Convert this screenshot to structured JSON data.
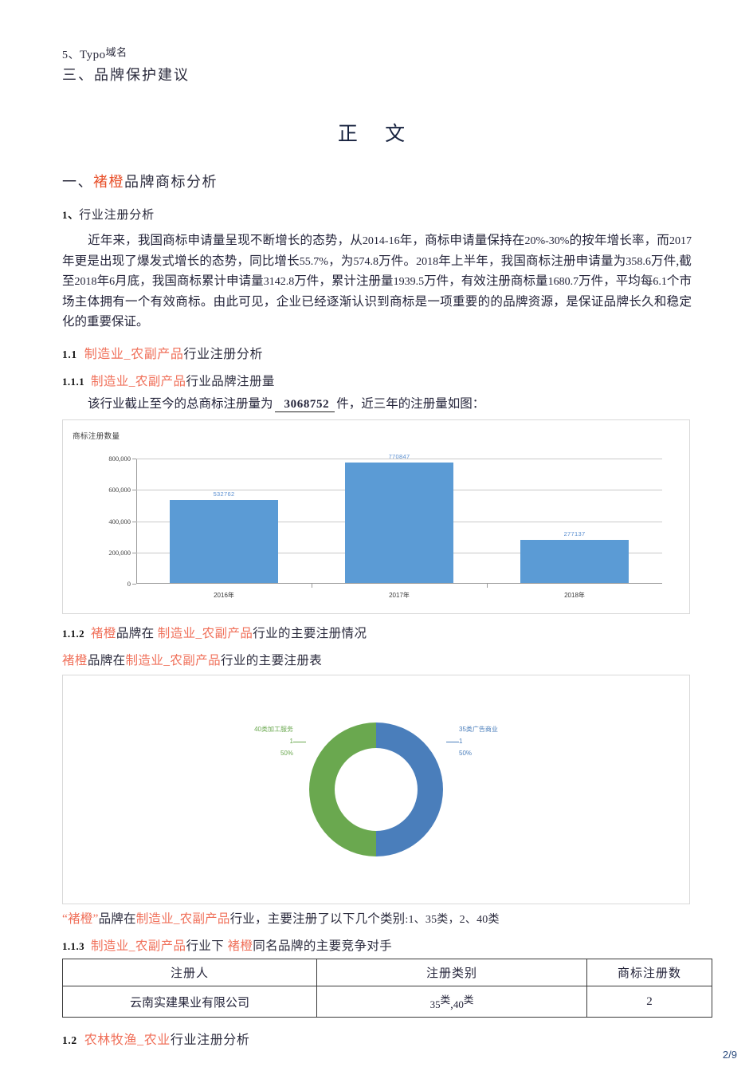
{
  "page": {
    "number_label": "2/9"
  },
  "header": {
    "toc_item_5_num": "5、",
    "toc_item_5_text": "Typo",
    "toc_item_5_sup": "域名",
    "toc_item_3": "三、品牌保护建议",
    "doc_title": "正  文"
  },
  "sections": {
    "s1_title_num": "一、",
    "s1_title_brand": "褚橙",
    "s1_title_rest": "品牌商标分析",
    "s1_1_num": "1、",
    "s1_1_label": "行业注册分析",
    "paragraph": {
      "t1": "近年来，我国商标申请量呈现不断增长的态势，从",
      "n1": "2014-16",
      "t2": "年，商标申请量保持在",
      "n2": "20%-30%",
      "t3": "的按年增长率，而",
      "n3": "2017",
      "t4": "年更是出现了爆发式增长的态势，同比增长",
      "n4": "55.7%",
      "t5": "，为",
      "n5": "574.8",
      "t6": "万件。",
      "n6": "2018",
      "t7": "年上半年，我国商标注册申请量为",
      "n7": "358.6",
      "t8": "万件",
      "t9": ",截至",
      "n8": "2018",
      "t10": "年",
      "n9": "6",
      "t11": "月底，我国商标累计申请量",
      "n10": "3142.8",
      "t12": "万件，累计注册量",
      "n11": "1939.5",
      "t13": "万件，有效注册商标量",
      "n12": "1680.7",
      "t14": "万件，平均每",
      "n13": "6.1",
      "t15": "个市场主体拥有一个有效商标。由此可见，企业已经逐渐认识到商标是一项重要的的品牌资源，是保证品牌长久和稳定化的重要保证。"
    },
    "h_1_1": {
      "num": "1.1",
      "industry": "制造业_农副产品",
      "rest": "行业注册分析"
    },
    "h_1_1_1": {
      "num": "1.1.1",
      "industry": "制造业_农副产品",
      "rest": "行业品牌注册量"
    },
    "count_line": {
      "prefix": "该行业截止至今的总商标注册量为",
      "value": "3068752",
      "suffix": "件，近三年的注册量如图："
    },
    "h_1_1_2": {
      "num": "1.1.2",
      "brand": "褚橙",
      "mid": "品牌在 ",
      "industry": "制造业_农副产品",
      "rest": "行业的主要注册情况"
    },
    "sub_1_1_2": {
      "brand": "褚橙",
      "mid": "品牌在",
      "industry": "制造业_农副产品",
      "rest": "行业的主要注册表"
    },
    "after_donut": {
      "q1": "“",
      "brand": "褚橙",
      "q2": "”",
      "mid": "品牌在",
      "industry": "制造业_农副产品",
      "rest": "行业，主要注册了以下几个类别",
      "tail": ":1、35类，2、40类"
    },
    "h_1_1_3": {
      "num": "1.1.3",
      "industry": "制造业_农副产品",
      "mid": "行业下 ",
      "brand": "褚橙",
      "rest": "同名品牌的主要竞争对手"
    },
    "h_1_2": {
      "num": "1.2",
      "industry": "农林牧渔_农业",
      "rest": "行业注册分析"
    }
  },
  "table": {
    "headers": [
      "注册人",
      "注册类别",
      "商标注册数"
    ],
    "rows": [
      {
        "registrant": "云南实建果业有限公司",
        "category_a": "35",
        "category_a_unit": "类",
        "category_sep": ",",
        "category_b": "40",
        "category_b_unit": "类",
        "count": "2"
      }
    ]
  },
  "chart_data": [
    {
      "type": "bar",
      "title": "",
      "ylabel": "商标注册数量",
      "xlabel": "",
      "categories": [
        "2016年",
        "2017年",
        "2018年"
      ],
      "values": [
        532762,
        770847,
        277137
      ],
      "value_labels": [
        "532762",
        "770847",
        "277137"
      ],
      "ylim": [
        0,
        800000
      ],
      "yticks": [
        0,
        200000,
        400000,
        600000,
        800000
      ],
      "ytick_labels": [
        "0",
        "200,000",
        "400,000",
        "600,000",
        "800,000"
      ],
      "grid": true,
      "legend": "none",
      "bar_color": "#5b9bd5",
      "label_color": "#5b8fd0"
    },
    {
      "type": "pie",
      "variant": "donut",
      "title": "",
      "labels": [
        "35类广告商业",
        "40类加工服务"
      ],
      "values": [
        1,
        1
      ],
      "percent_labels": [
        "50%",
        "50%"
      ],
      "value_labels": [
        "1",
        "1"
      ],
      "colors": [
        "#4a7ebb",
        "#6aa84f"
      ],
      "legend": "outside-labels"
    }
  ]
}
